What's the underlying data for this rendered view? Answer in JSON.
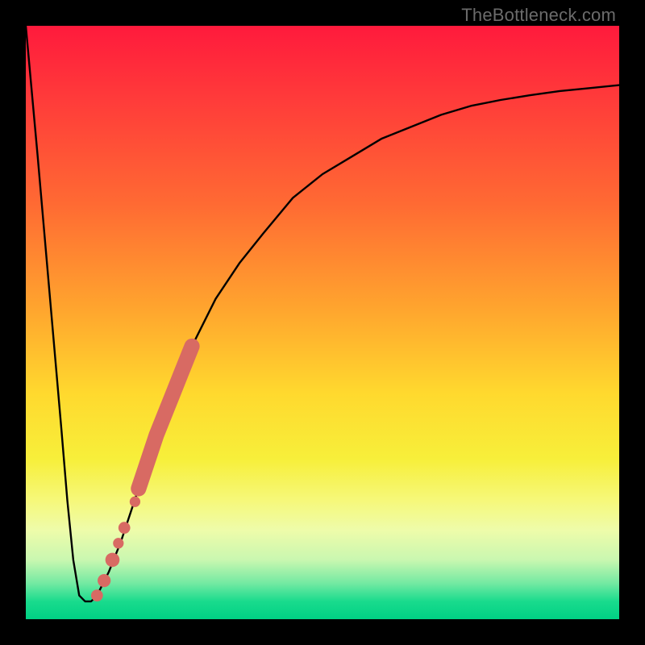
{
  "attribution": "TheBottleneck.com",
  "chart_data": {
    "type": "line",
    "title": "",
    "xlabel": "",
    "ylabel": "",
    "xlim": [
      0,
      100
    ],
    "ylim": [
      0,
      100
    ],
    "grid": false,
    "legend": false,
    "series": [
      {
        "name": "bottleneck-curve",
        "color": "#000000",
        "x": [
          0,
          2,
          4,
          6,
          7,
          8,
          9,
          10,
          11,
          12,
          14,
          16,
          18,
          20,
          22,
          24,
          28,
          32,
          36,
          40,
          45,
          50,
          55,
          60,
          65,
          70,
          75,
          80,
          85,
          90,
          95,
          100
        ],
        "y": [
          100,
          78,
          55,
          32,
          20,
          10,
          4,
          3,
          3,
          4,
          8,
          13,
          19,
          25,
          31,
          36,
          46,
          54,
          60,
          65,
          71,
          75,
          78,
          81,
          83,
          85,
          86.5,
          87.5,
          88.3,
          89,
          89.5,
          90
        ]
      }
    ],
    "highlights": [
      {
        "name": "highlight-dot-1",
        "x": 12.0,
        "y": 4.0,
        "r": 1.0,
        "color": "#d86a63"
      },
      {
        "name": "highlight-dot-2",
        "x": 13.2,
        "y": 6.5,
        "r": 1.1,
        "color": "#d86a63"
      },
      {
        "name": "highlight-dot-3",
        "x": 14.6,
        "y": 10.0,
        "r": 1.2,
        "color": "#d86a63"
      },
      {
        "name": "highlight-dot-4",
        "x": 15.6,
        "y": 12.8,
        "r": 0.9,
        "color": "#d86a63"
      },
      {
        "name": "highlight-dot-5",
        "x": 16.6,
        "y": 15.4,
        "r": 1.0,
        "color": "#d86a63"
      },
      {
        "name": "highlight-dot-6",
        "x": 18.4,
        "y": 19.8,
        "r": 0.9,
        "color": "#d86a63"
      }
    ],
    "highlight_stroke": {
      "name": "highlight-stroke",
      "color": "#d86a63",
      "width": 2.6,
      "x": [
        19.0,
        20.0,
        21.0,
        22.0,
        23.0,
        24.0,
        25.0,
        26.0,
        27.0,
        28.0
      ],
      "y": [
        22.0,
        25.0,
        28.0,
        31.0,
        33.5,
        36.0,
        38.5,
        41.0,
        43.5,
        46.0
      ]
    }
  }
}
